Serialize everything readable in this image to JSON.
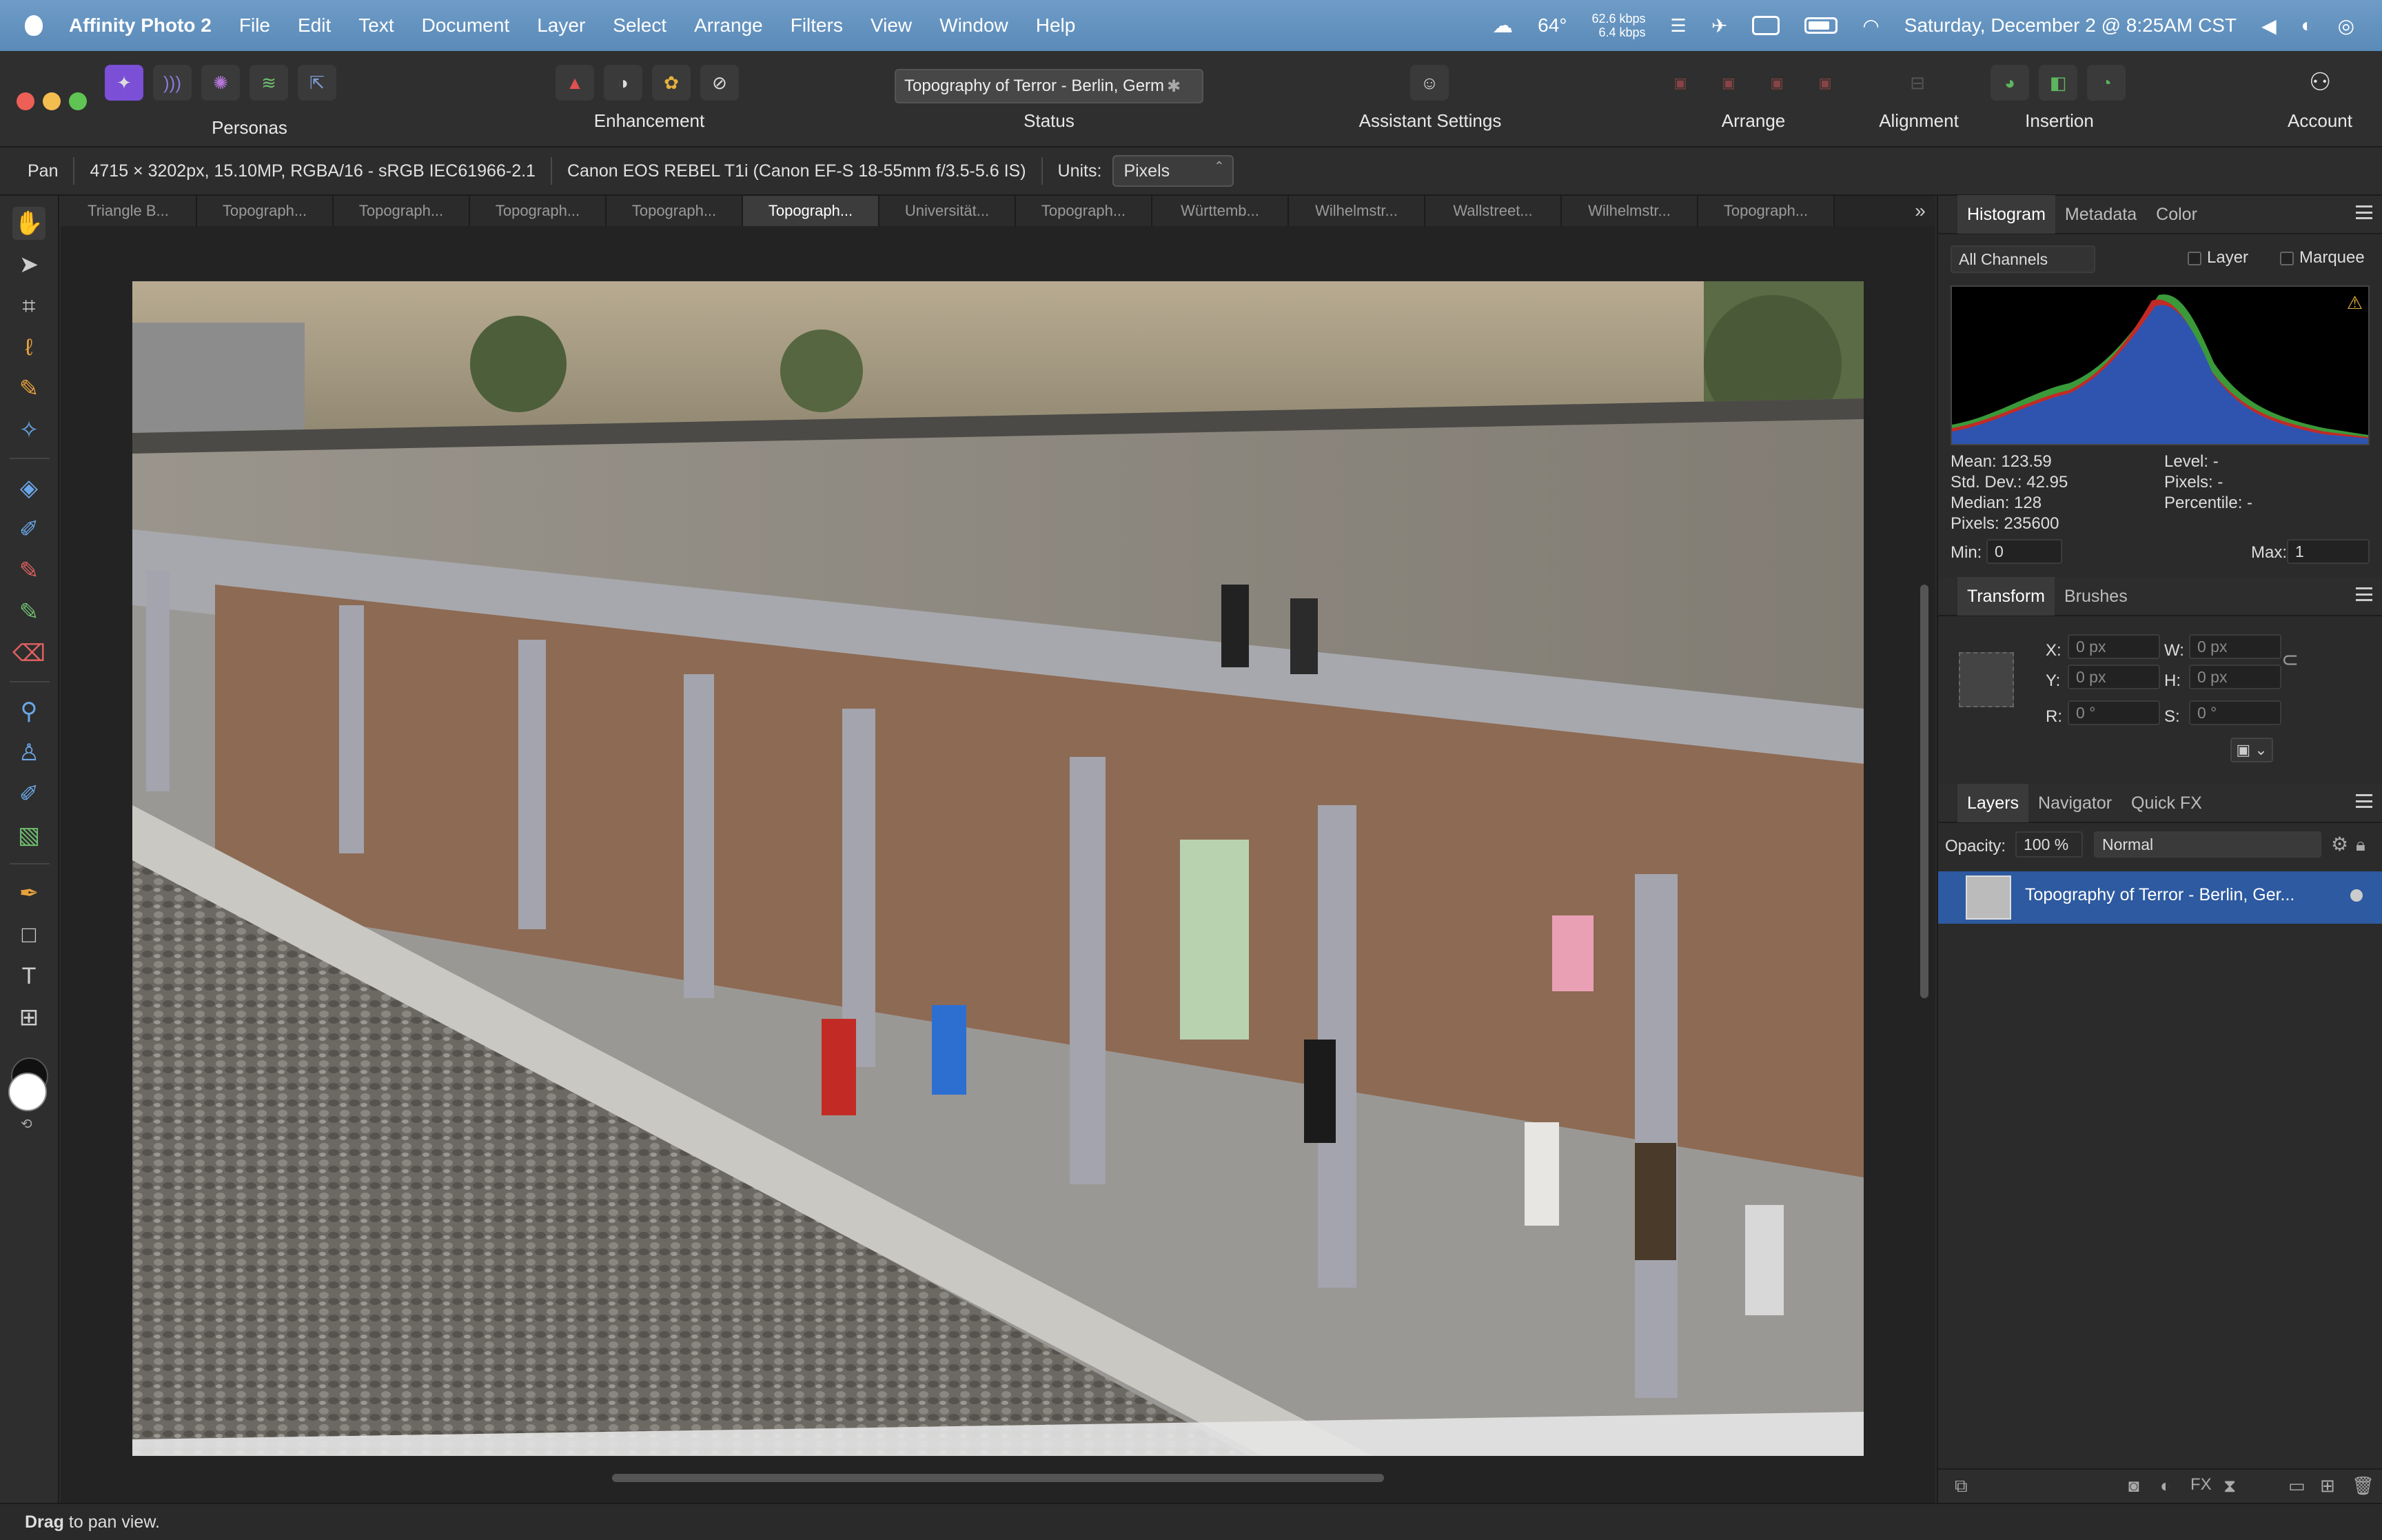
{
  "menubar": {
    "app_name": "Affinity Photo 2",
    "items": [
      "File",
      "Edit",
      "Text",
      "Document",
      "Layer",
      "Select",
      "Arrange",
      "Filters",
      "View",
      "Window",
      "Help"
    ],
    "weather": "64°",
    "net_up": "62.6 kbps",
    "net_down": "6.4 kbps",
    "datetime": "Saturday, December 2 @ 8:25AM CST"
  },
  "toolbar": {
    "personas_label": "Personas",
    "enhancement_label": "Enhancement",
    "status_label": "Status",
    "document_title": "Topography of Terror - Berlin, Germ",
    "assistant_label": "Assistant Settings",
    "arrange_label": "Arrange",
    "alignment_label": "Alignment",
    "insertion_label": "Insertion",
    "account_label": "Account"
  },
  "contextbar": {
    "tool": "Pan",
    "doc_info": "4715 × 3202px, 15.10MP, RGBA/16 - sRGB IEC61966-2.1",
    "camera": "Canon EOS REBEL T1i (Canon EF-S 18-55mm f/3.5-5.6 IS)",
    "units_label": "Units:",
    "units_value": "Pixels"
  },
  "tabs": [
    "Triangle B...",
    "Topograph...",
    "Topograph...",
    "Topograph...",
    "Topograph...",
    "Topograph...",
    "Universität...",
    "Topograph...",
    "Württemb...",
    "Wilhelmstr...",
    "Wallstreet...",
    "Wilhelmstr...",
    "Topograph..."
  ],
  "active_tab": 5,
  "histogram": {
    "tabs": [
      "Histogram",
      "Metadata",
      "Color"
    ],
    "channel": "All Channels",
    "layer_label": "Layer",
    "marquee_label": "Marquee",
    "mean": "Mean: 123.59",
    "std": "Std. Dev.: 42.95",
    "median": "Median: 128",
    "pixels": "Pixels: 235600",
    "level": "Level: -",
    "pixels_sel": "Pixels: -",
    "percentile": "Percentile: -",
    "min_label": "Min:",
    "min_value": "0",
    "max_label": "Max:",
    "max_value": "1"
  },
  "transform": {
    "tabs": [
      "Transform",
      "Brushes"
    ],
    "x_label": "X:",
    "x_value": "0 px",
    "y_label": "Y:",
    "y_value": "0 px",
    "w_label": "W:",
    "w_value": "0 px",
    "h_label": "H:",
    "h_value": "0 px",
    "r_label": "R:",
    "r_value": "0 °",
    "s_label": "S:",
    "s_value": "0 °"
  },
  "layers": {
    "tabs": [
      "Layers",
      "Navigator",
      "Quick FX"
    ],
    "opacity_label": "Opacity:",
    "opacity_value": "100 %",
    "blend_mode": "Normal",
    "layer_name": "Topography of Terror - Berlin, Ger..."
  },
  "statusbar": {
    "bold": "Drag",
    "text": " to pan view."
  },
  "colors": {
    "menubar": "#6a97c3",
    "accent": "#2d5aa0",
    "persona_purple": "#7b4fd6"
  }
}
